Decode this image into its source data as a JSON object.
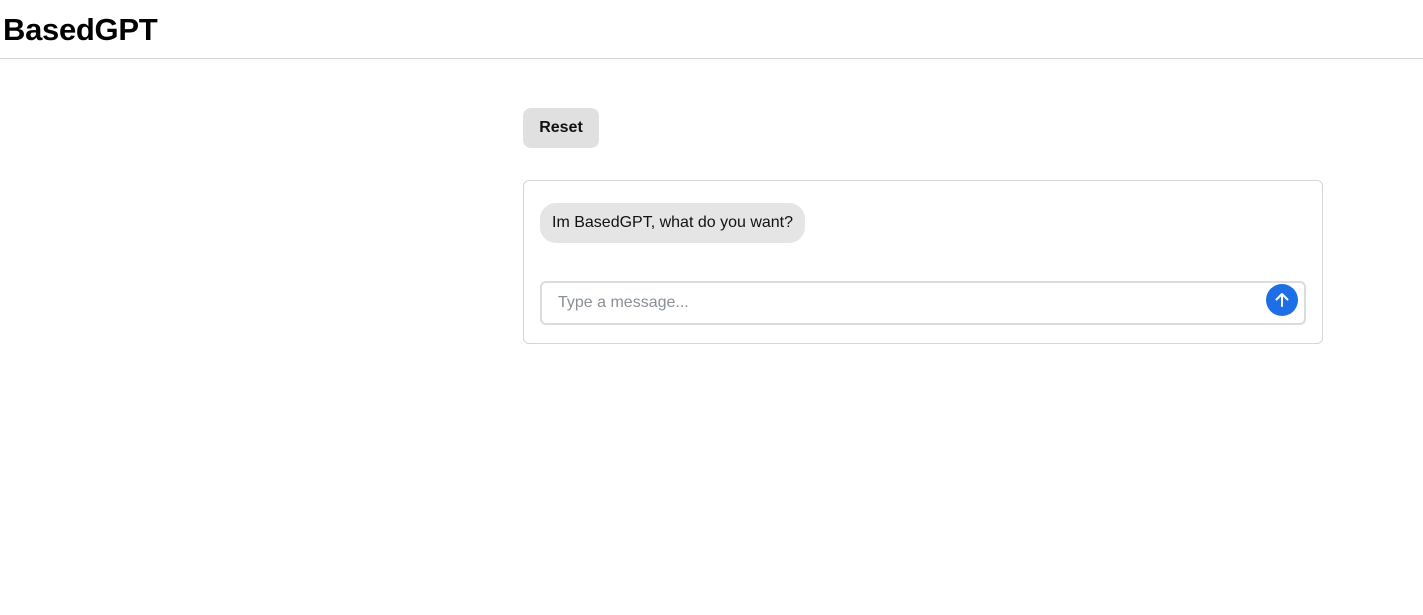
{
  "header": {
    "title": "BasedGPT"
  },
  "controls": {
    "reset_label": "Reset"
  },
  "chat": {
    "messages": [
      {
        "role": "assistant",
        "text": "Im BasedGPT, what do you want?"
      }
    ],
    "input": {
      "value": "",
      "placeholder": "Type a message..."
    },
    "send_icon": "arrow-up-icon"
  },
  "colors": {
    "accent": "#1e6fe6",
    "bubble_bg": "#e5e5e5",
    "reset_bg": "#e0e0e0"
  }
}
